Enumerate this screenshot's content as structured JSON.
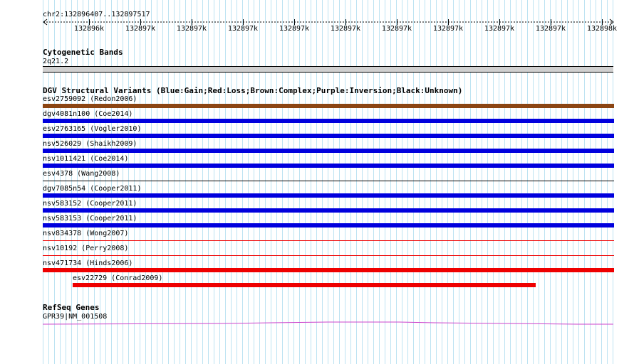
{
  "ruler": {
    "range_label": "chr2:132896407..132897517",
    "tick_labels": [
      "132896k",
      "132897k",
      "132897k",
      "132897k",
      "132897k",
      "132897k",
      "132897k",
      "132897k",
      "132897k",
      "132897k",
      "132898k"
    ]
  },
  "cytogenetic": {
    "title": "Cytogenetic Bands",
    "band_label": "2q21.2"
  },
  "dgv": {
    "title": "DGV Structural Variants (Blue:Gain;Red:Loss;Brown:Complex;Purple:Inversion;Black:Unknown)",
    "colors": {
      "gain": "#0000dd",
      "loss": "#ee0000",
      "complex": "#8b4513",
      "inversion": "#800080",
      "unknown": "#000000"
    },
    "features": [
      {
        "label": "esv2759092 (Redon2006)",
        "type": "complex",
        "thick": true
      },
      {
        "label": "dgv4081n100 (Coe2014)",
        "type": "gain",
        "thick": true
      },
      {
        "label": "esv2763165 (Vogler2010)",
        "type": "gain",
        "thick": true
      },
      {
        "label": "nsv526029 (Shaikh2009)",
        "type": "gain",
        "thick": true
      },
      {
        "label": "nsv1011421 (Coe2014)",
        "type": "gain",
        "thick": true
      },
      {
        "label": "esv4378 (Wang2008)",
        "type": "unknown",
        "thick": false
      },
      {
        "label": "dgv7085n54 (Cooper2011)",
        "type": "gain",
        "thick": true
      },
      {
        "label": "nsv583152 (Cooper2011)",
        "type": "gain",
        "thick": true
      },
      {
        "label": "nsv583153 (Cooper2011)",
        "type": "gain",
        "thick": true
      },
      {
        "label": "nsv834378 (Wong2007)",
        "type": "loss",
        "thick": false
      },
      {
        "label": "nsv10192 (Perry2008)",
        "type": "loss",
        "thick": false
      },
      {
        "label": "nsv471734 (Hinds2006)",
        "type": "loss",
        "thick": true
      },
      {
        "label": "esv22729 (Conrad2009)",
        "type": "loss",
        "thick": true,
        "partial": true
      }
    ]
  },
  "refseq": {
    "title": "RefSeq Genes",
    "gene_label": "GPR39|NM_001508",
    "color": "#cc44cc"
  }
}
